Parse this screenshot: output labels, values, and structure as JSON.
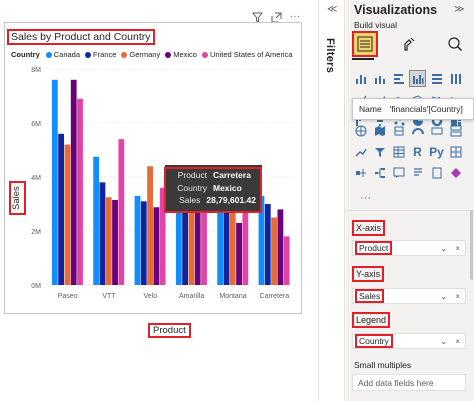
{
  "chart_data": {
    "type": "bar",
    "title": "Sales by Product and Country",
    "xlabel": "Product",
    "ylabel": "Sales",
    "categories": [
      "Paseo",
      "VTT",
      "Velo",
      "Amarilla",
      "Montana",
      "Carretera"
    ],
    "legend_title": "Country",
    "legend_position": "top-left",
    "ylim": [
      0,
      8000000
    ],
    "yticks": [
      {
        "v": 0,
        "label": "0M"
      },
      {
        "v": 2000000,
        "label": "2M"
      },
      {
        "v": 4000000,
        "label": "4M"
      },
      {
        "v": 6000000,
        "label": "6M"
      },
      {
        "v": 8000000,
        "label": "8M"
      }
    ],
    "grid": true,
    "series": [
      {
        "name": "Canada",
        "color": "#118dff",
        "values": [
          7600000,
          4750000,
          3300000,
          3600000,
          3300000,
          3300000
        ]
      },
      {
        "name": "France",
        "color": "#12239e",
        "values": [
          5600000,
          3800000,
          3100000,
          3500000,
          3400000,
          3000000
        ]
      },
      {
        "name": "Germany",
        "color": "#e66c37",
        "values": [
          5200000,
          3250000,
          4400000,
          2800000,
          3100000,
          2500000
        ]
      },
      {
        "name": "Mexico",
        "color": "#6b007b",
        "values": [
          7600000,
          3150000,
          2879601,
          3300000,
          2300000,
          2800000
        ]
      },
      {
        "name": "United States of America",
        "color": "#e044a7",
        "values": [
          6900000,
          5400000,
          3600000,
          3100000,
          3200000,
          1800000
        ]
      }
    ]
  },
  "visual": {
    "toolbar": {
      "filter_icon": "filter-icon",
      "focus_icon": "focus-mode-icon",
      "more_icon": "more-options-icon"
    }
  },
  "tooltip": {
    "rows": [
      {
        "key": "Product",
        "value": "Carretera"
      },
      {
        "key": "Country",
        "value": "Mexico"
      },
      {
        "key": "Sales",
        "value": "28,79,601.42"
      }
    ]
  },
  "filters_pane": {
    "label": "Filters",
    "collapse_icon": "chevron-left-icon"
  },
  "viz_pane": {
    "title": "Visualizations",
    "collapse_icon": "chevron-right-icon",
    "build_visual_label": "Build visual",
    "tabs": [
      {
        "icon": "build-visual-icon",
        "selected": true
      },
      {
        "icon": "format-visual-icon",
        "selected": false
      },
      {
        "icon": "analytics-icon",
        "selected": false
      }
    ],
    "name_tooltip": {
      "key": "Name",
      "value": "'financials'[Country]"
    },
    "more_label": "···",
    "wells": {
      "xaxis": {
        "label": "X-axis",
        "field": "Product"
      },
      "yaxis": {
        "label": "Y-axis",
        "field": "Sales"
      },
      "legend": {
        "label": "Legend",
        "field": "Country"
      },
      "small_multiples": {
        "label": "Small multiples",
        "placeholder": "Add data fields here"
      }
    },
    "well_controls": "⌄ ×"
  }
}
